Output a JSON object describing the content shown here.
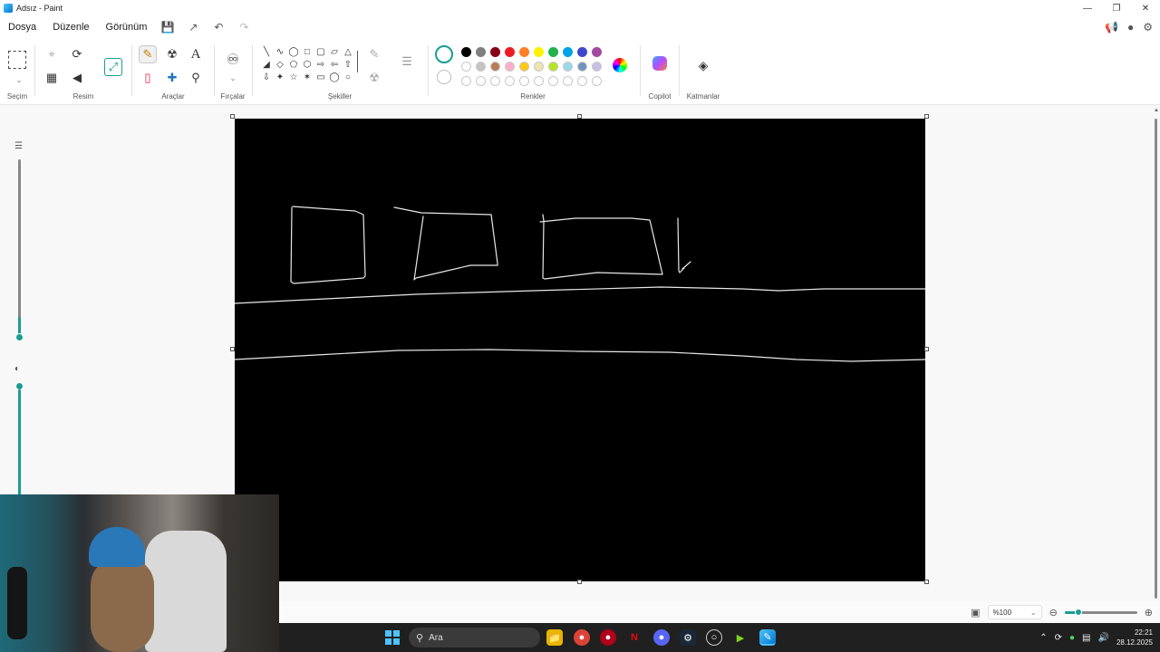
{
  "window": {
    "title": "Adsız - Paint"
  },
  "menu": {
    "file": "Dosya",
    "edit": "Düzenle",
    "view": "Görünüm"
  },
  "ribbon": {
    "selection_label": "Seçim",
    "image_label": "Resim",
    "tools_label": "Araçlar",
    "brushes_label": "Fırçalar",
    "shapes_label": "Şekiller",
    "colors_label": "Renkler",
    "copilot_label": "Copilot",
    "layers_label": "Katmanlar",
    "palette_row1": [
      "#000000",
      "#7f7f7f",
      "#880015",
      "#ed1c24",
      "#ff7f27",
      "#fff200",
      "#22b14c",
      "#00a2e8",
      "#3f48cc",
      "#a349a4"
    ],
    "palette_row2": [
      "#ffffff",
      "#c3c3c3",
      "#b97a57",
      "#ffaec9",
      "#ffc90e",
      "#efe4b0",
      "#b5e61d",
      "#99d9ea",
      "#7092be",
      "#c8bfe7"
    ],
    "accent": "#1a9c94"
  },
  "status": {
    "zoom": "%100"
  },
  "taskbar": {
    "search_placeholder": "Ara",
    "time": "22:21",
    "date": "28.12.2025"
  }
}
